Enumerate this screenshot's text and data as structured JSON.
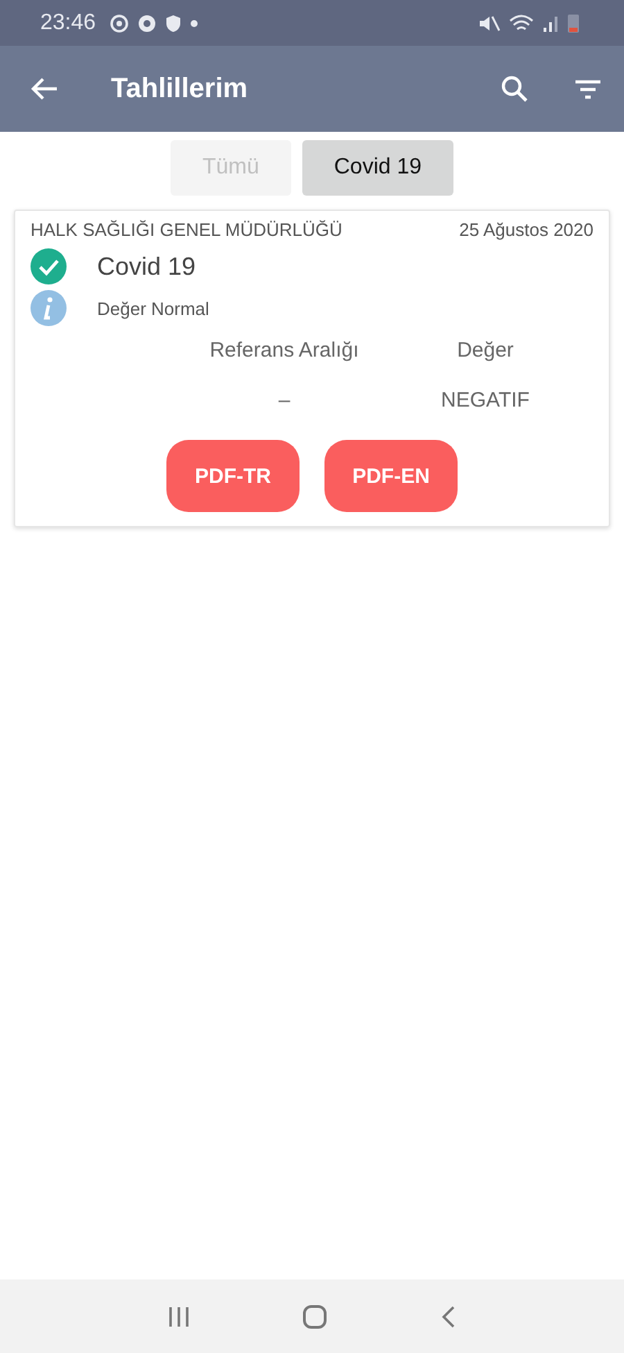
{
  "status_bar": {
    "time": "23:46"
  },
  "app_bar": {
    "title": "Tahlillerim"
  },
  "tabs": [
    {
      "label": "Tümü",
      "selected": false
    },
    {
      "label": "Covid 19",
      "selected": true
    }
  ],
  "results": [
    {
      "institution": "HALK SAĞLIĞI GENEL MÜDÜRLÜĞÜ",
      "date": "25 Ağustos 2020",
      "test": "Covid 19",
      "verified": true,
      "note": "Değer Normal",
      "columns": [
        "Referans Aralığı",
        "Değer"
      ],
      "values": [
        "–",
        "NEGATIF"
      ],
      "buttons": [
        "PDF-TR",
        "PDF-EN"
      ]
    }
  ]
}
